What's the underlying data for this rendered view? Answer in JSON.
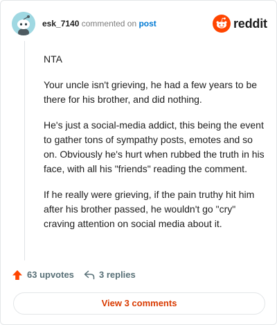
{
  "header": {
    "username": "esk_7140",
    "action_text": "commented on",
    "post_link": "post",
    "brand": "reddit"
  },
  "comment": {
    "paragraphs": [
      "NTA",
      "Your uncle isn't grieving, he had a few years to be there for his brother, and did nothing.",
      "He's just a social-media addict, this being the event to gather tons of sympathy posts, emotes and so on. Obviously he's hurt when rubbed the truth in his face, with all his \"friends\" reading the comment.",
      "If he really were grieving, if the pain truthy hit him after his brother passed, he wouldn't go \"cry\" craving attention on social media about it."
    ]
  },
  "actions": {
    "upvotes": "63 upvotes",
    "replies": "3 replies"
  },
  "footer": {
    "view_comments": "View 3 comments"
  },
  "colors": {
    "accent": "#ff4500",
    "link": "#0079d3",
    "button_text": "#d93a00",
    "muted": "#576f76"
  },
  "icons": {
    "avatar": "snoo-avatar-icon",
    "brand": "reddit-logo-icon",
    "upvote": "upvote-arrow-icon",
    "reply": "reply-arrow-icon"
  }
}
